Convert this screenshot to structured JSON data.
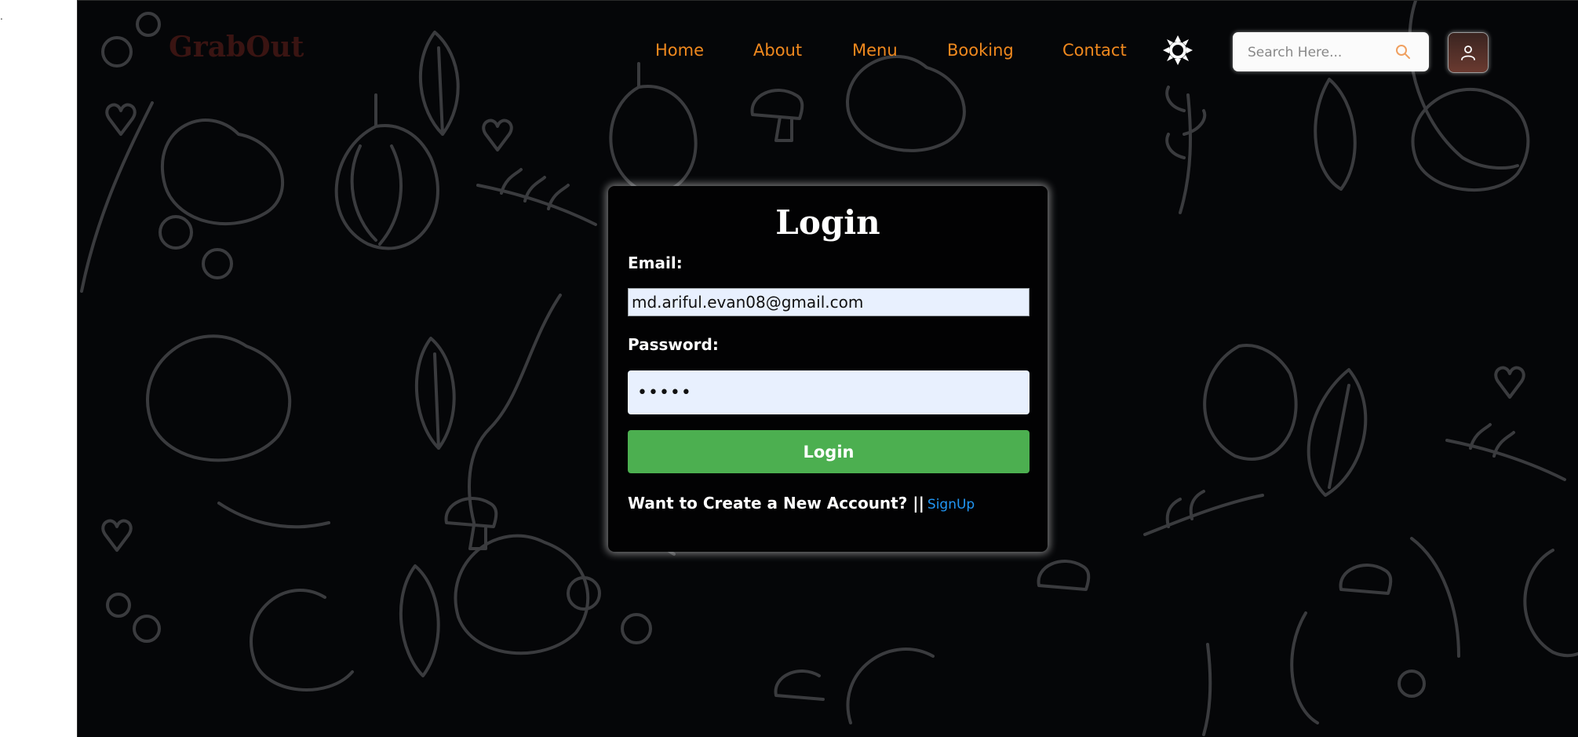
{
  "stray_mark": ".",
  "header": {
    "logo": "GrabOut",
    "nav": [
      "Home",
      "About",
      "Menu",
      "Booking",
      "Contact"
    ],
    "search_placeholder": "Search Here...",
    "accent_color": "#f0891e"
  },
  "login": {
    "title": "Login",
    "email_label": "Email:",
    "email_value": "md.ariful.evan08@gmail.com",
    "password_label": "Password:",
    "password_value": "•••••",
    "button_label": "Login",
    "signup_prompt": "Want to Create a New Account? ||",
    "signup_link": "SignUp"
  },
  "icons": {
    "theme": "sun-icon",
    "search": "search-icon",
    "profile": "user-icon"
  }
}
